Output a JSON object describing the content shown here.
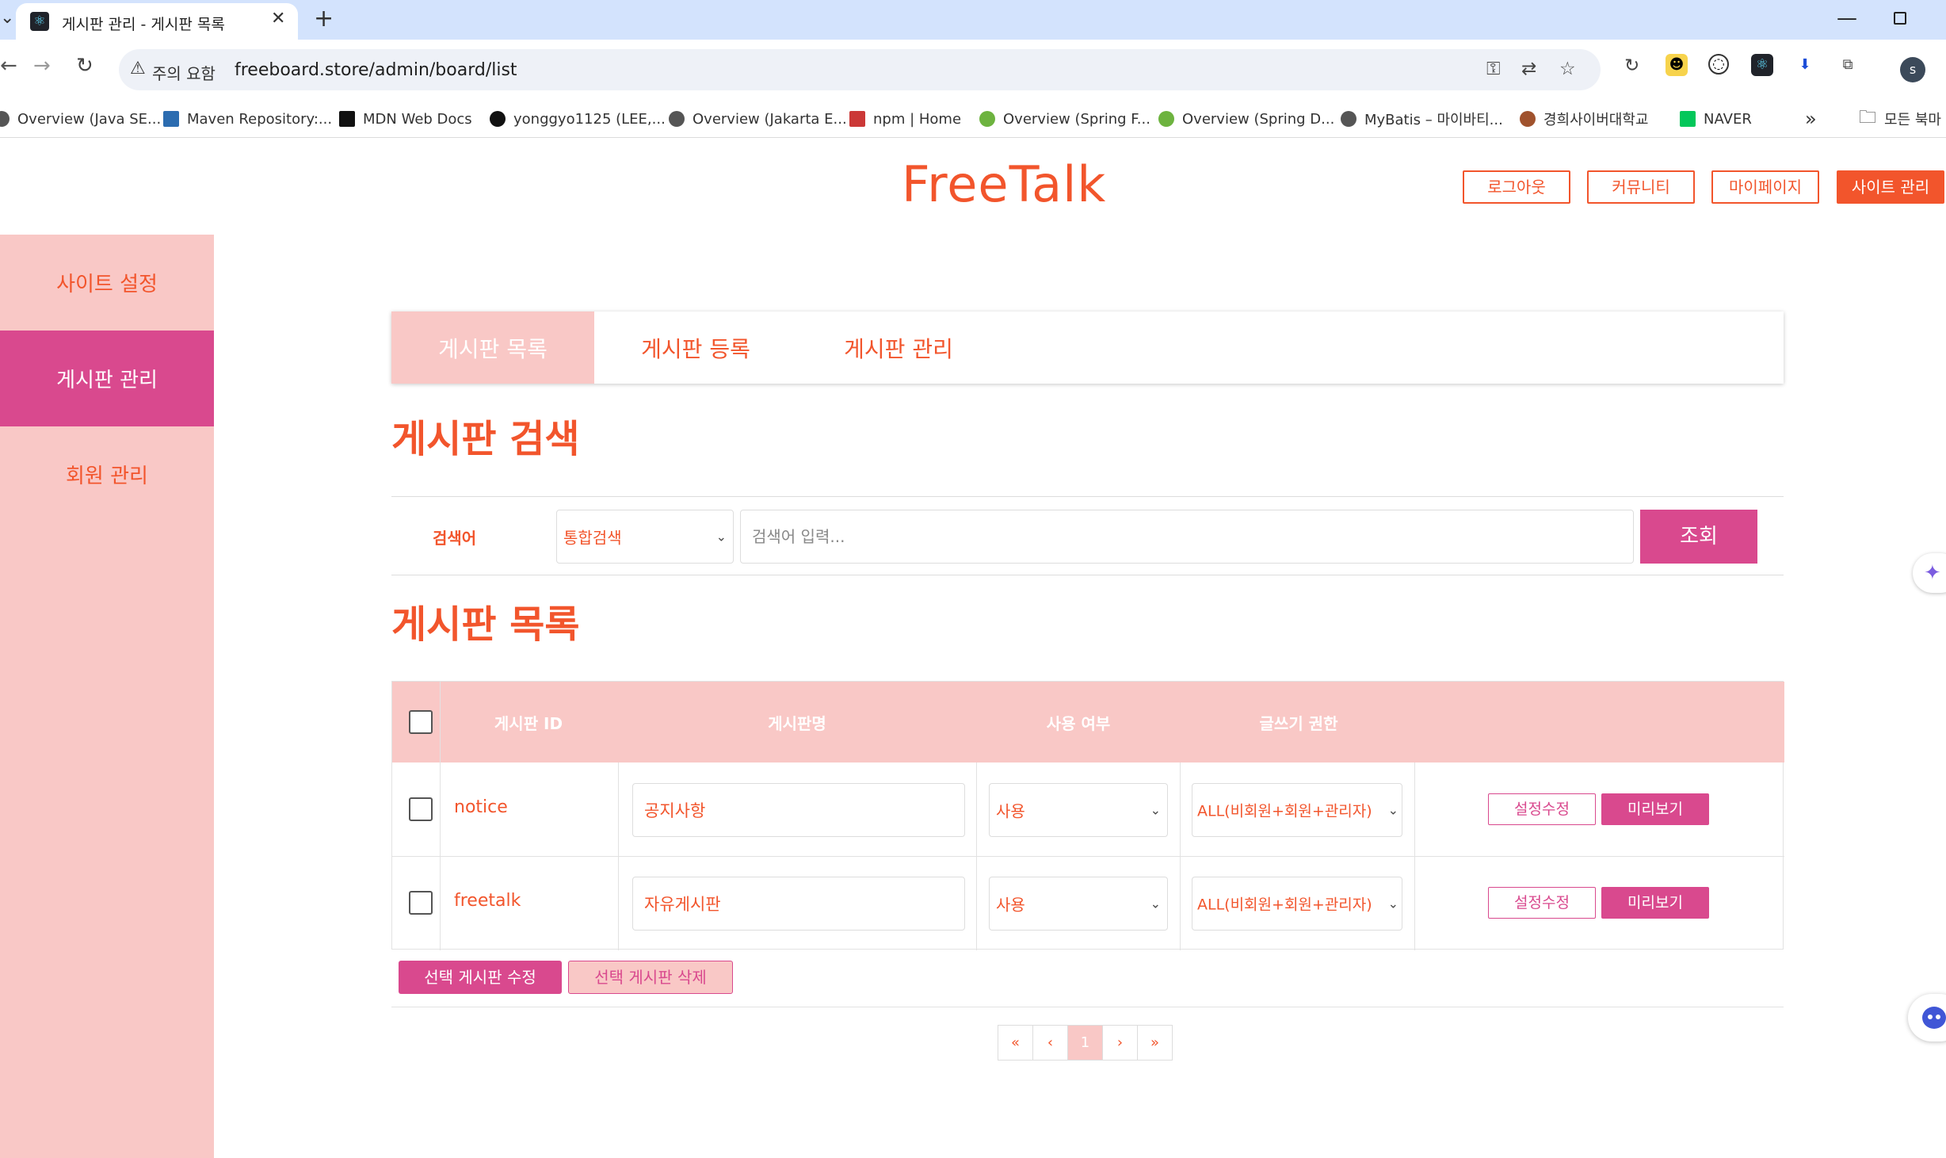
{
  "browser": {
    "tab_title": "게시판 관리 - 게시판 목록",
    "security_label": "주의 요함",
    "url": "freeboard.store/admin/board/list",
    "profile_initial": "s",
    "bookmarks": [
      {
        "label": "Overview (Java SE...",
        "icon": "globe-icon",
        "color": "#555555"
      },
      {
        "label": "Maven Repository:...",
        "icon": "maven-icon",
        "color": "#2b6cb0"
      },
      {
        "label": "MDN Web Docs",
        "icon": "mdn-icon",
        "color": "#111111"
      },
      {
        "label": "yonggyo1125 (LEE,...",
        "icon": "github-icon",
        "color": "#111111"
      },
      {
        "label": "Overview (Jakarta E...",
        "icon": "globe-icon",
        "color": "#555555"
      },
      {
        "label": "npm | Home",
        "icon": "npm-icon",
        "color": "#cb3837"
      },
      {
        "label": "Overview (Spring F...",
        "icon": "spring-icon",
        "color": "#6db33f"
      },
      {
        "label": "Overview (Spring D...",
        "icon": "spring-icon",
        "color": "#6db33f"
      },
      {
        "label": "MyBatis – 마이바티...",
        "icon": "globe-icon",
        "color": "#555555"
      },
      {
        "label": "경희사이버대학교",
        "icon": "school-icon",
        "color": "#a0522d"
      },
      {
        "label": "NAVER",
        "icon": "naver-icon",
        "color": "#03c75a"
      }
    ],
    "more_label": "»",
    "all_bookmarks_label": "모든 북마"
  },
  "header": {
    "logo": "FreeTalk",
    "buttons": [
      "로그아웃",
      "커뮤니티",
      "마이페이지",
      "사이트 관리"
    ]
  },
  "sidebar": {
    "items": [
      "사이트 설정",
      "게시판 관리",
      "회원 관리"
    ],
    "active_index": 1
  },
  "subtabs": {
    "items": [
      "게시판 목록",
      "게시판 등록",
      "게시판 관리"
    ],
    "active_index": 0
  },
  "search": {
    "heading": "게시판 검색",
    "label": "검색어",
    "select_value": "통합검색",
    "placeholder": "검색어 입력...",
    "button": "조회"
  },
  "list": {
    "heading": "게시판 목록",
    "columns": [
      "게시판 ID",
      "게시판명",
      "사용 여부",
      "글쓰기 권한"
    ],
    "rows": [
      {
        "id": "notice",
        "name": "공지사항",
        "use": "사용",
        "permission": "ALL(비회원+회원+관리자)",
        "edit_label": "설정수정",
        "preview_label": "미리보기"
      },
      {
        "id": "freetalk",
        "name": "자유게시판",
        "use": "사용",
        "permission": "ALL(비회원+회원+관리자)",
        "edit_label": "설정수정",
        "preview_label": "미리보기"
      }
    ],
    "modify_selected": "선택 게시판 수정",
    "delete_selected": "선택 게시판 삭제"
  },
  "pagination": {
    "first": "«",
    "prev": "‹",
    "current": "1",
    "next": "›",
    "last": "»"
  },
  "colors": {
    "accent_orange": "#f2552c",
    "accent_pink": "#d9498e",
    "light_pink": "#f9c8c6"
  }
}
